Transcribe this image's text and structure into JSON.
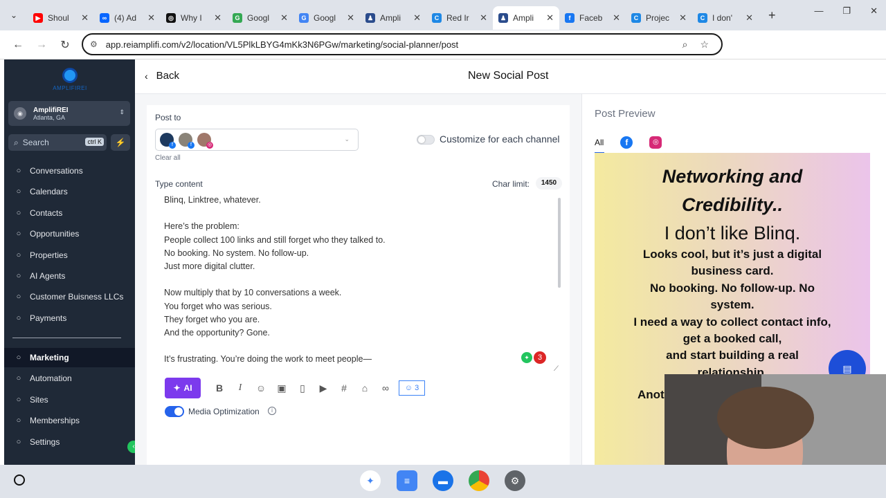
{
  "browser": {
    "tabs": [
      {
        "title": "Shoul",
        "fav_color": "#ff0000",
        "fav_glyph": "▶"
      },
      {
        "title": "(4) Ad",
        "fav_color": "#0866ff",
        "fav_glyph": "∞"
      },
      {
        "title": "Why I",
        "fav_color": "#111111",
        "fav_glyph": "◎"
      },
      {
        "title": "Googl",
        "fav_color": "#34a853",
        "fav_glyph": "G"
      },
      {
        "title": "Googl",
        "fav_color": "#4285f4",
        "fav_glyph": "G"
      },
      {
        "title": "Ampli",
        "fav_color": "#2b4c8c",
        "fav_glyph": "♟"
      },
      {
        "title": "Red Ir",
        "fav_color": "#1e88e5",
        "fav_glyph": "C"
      },
      {
        "title": "Ampli",
        "fav_color": "#2b4c8c",
        "fav_glyph": "♟"
      },
      {
        "title": "Faceb",
        "fav_color": "#1877f2",
        "fav_glyph": "f"
      },
      {
        "title": "Projec",
        "fav_color": "#1e88e5",
        "fav_glyph": "C"
      },
      {
        "title": "I don'",
        "fav_color": "#1e88e5",
        "fav_glyph": "C"
      }
    ],
    "active_tab_index": 7,
    "url": "app.reiamplifi.com/v2/location/VL5PlkLBYG4mKk3N6PGw/marketing/social-planner/post"
  },
  "sidebar": {
    "logo_text": "AMPLIFIREI",
    "account_name": "AmplifiREI",
    "account_location": "Atlanta, GA",
    "search_placeholder": "Search",
    "search_shortcut": "ctrl K",
    "nav": [
      {
        "label": "Conversations",
        "icon": "chat-icon"
      },
      {
        "label": "Calendars",
        "icon": "calendar-icon"
      },
      {
        "label": "Contacts",
        "icon": "contacts-icon"
      },
      {
        "label": "Opportunities",
        "icon": "opportunities-icon"
      },
      {
        "label": "Properties",
        "icon": "properties-icon"
      },
      {
        "label": "AI Agents",
        "icon": "ai-agents-icon"
      },
      {
        "label": "Customer Buisness LLCs",
        "icon": "building-icon"
      },
      {
        "label": "Payments",
        "icon": "payments-icon"
      }
    ],
    "nav2": [
      {
        "label": "Marketing",
        "icon": "marketing-icon",
        "active": true
      },
      {
        "label": "Automation",
        "icon": "automation-icon"
      },
      {
        "label": "Sites",
        "icon": "sites-icon"
      },
      {
        "label": "Memberships",
        "icon": "memberships-icon"
      },
      {
        "label": "Settings",
        "icon": "settings-icon"
      }
    ]
  },
  "header": {
    "back_label": "Back",
    "title": "New Social Post"
  },
  "editor": {
    "post_to_label": "Post to",
    "clear_all_label": "Clear all",
    "customize_label": "Customize for each channel",
    "type_content_label": "Type content",
    "char_limit_label": "Char limit:",
    "char_limit_value": "1450",
    "content_lines": [
      "Blinq, Linktree, whatever.",
      "",
      "Here’s the problem:",
      "People collect 100 links and still forget who they talked to.",
      "No booking. No system. No follow-up.",
      "Just more digital clutter.",
      "",
      "Now multiply that by 10 conversations a week.",
      "You forget who was serious.",
      "They forget who you are.",
      "And the opportunity? Gone.",
      "",
      "It’s frustrating. You’re doing the work to meet people—"
    ],
    "error_count": "3",
    "ai_label": "AI",
    "mention_count": "3",
    "media_optimization_label": "Media Optimization"
  },
  "preview": {
    "title": "Post Preview",
    "tab_all": "All",
    "image_heading_1": "Networking and",
    "image_heading_2": "Credibility..",
    "image_heading_3": "I don’t like Blinq.",
    "image_body": [
      "Looks cool, but it’s just a digital",
      "business card.",
      "No booking. No follow-up. No",
      "system.",
      "I need a way to collect contact info,",
      "get a booked call,",
      "and start building a real",
      "relationship."
    ],
    "image_partial": "Anot"
  },
  "colors": {
    "sidebar_bg": "#1f2937",
    "accent": "#2563eb",
    "ai_button": "#7c3aed"
  }
}
